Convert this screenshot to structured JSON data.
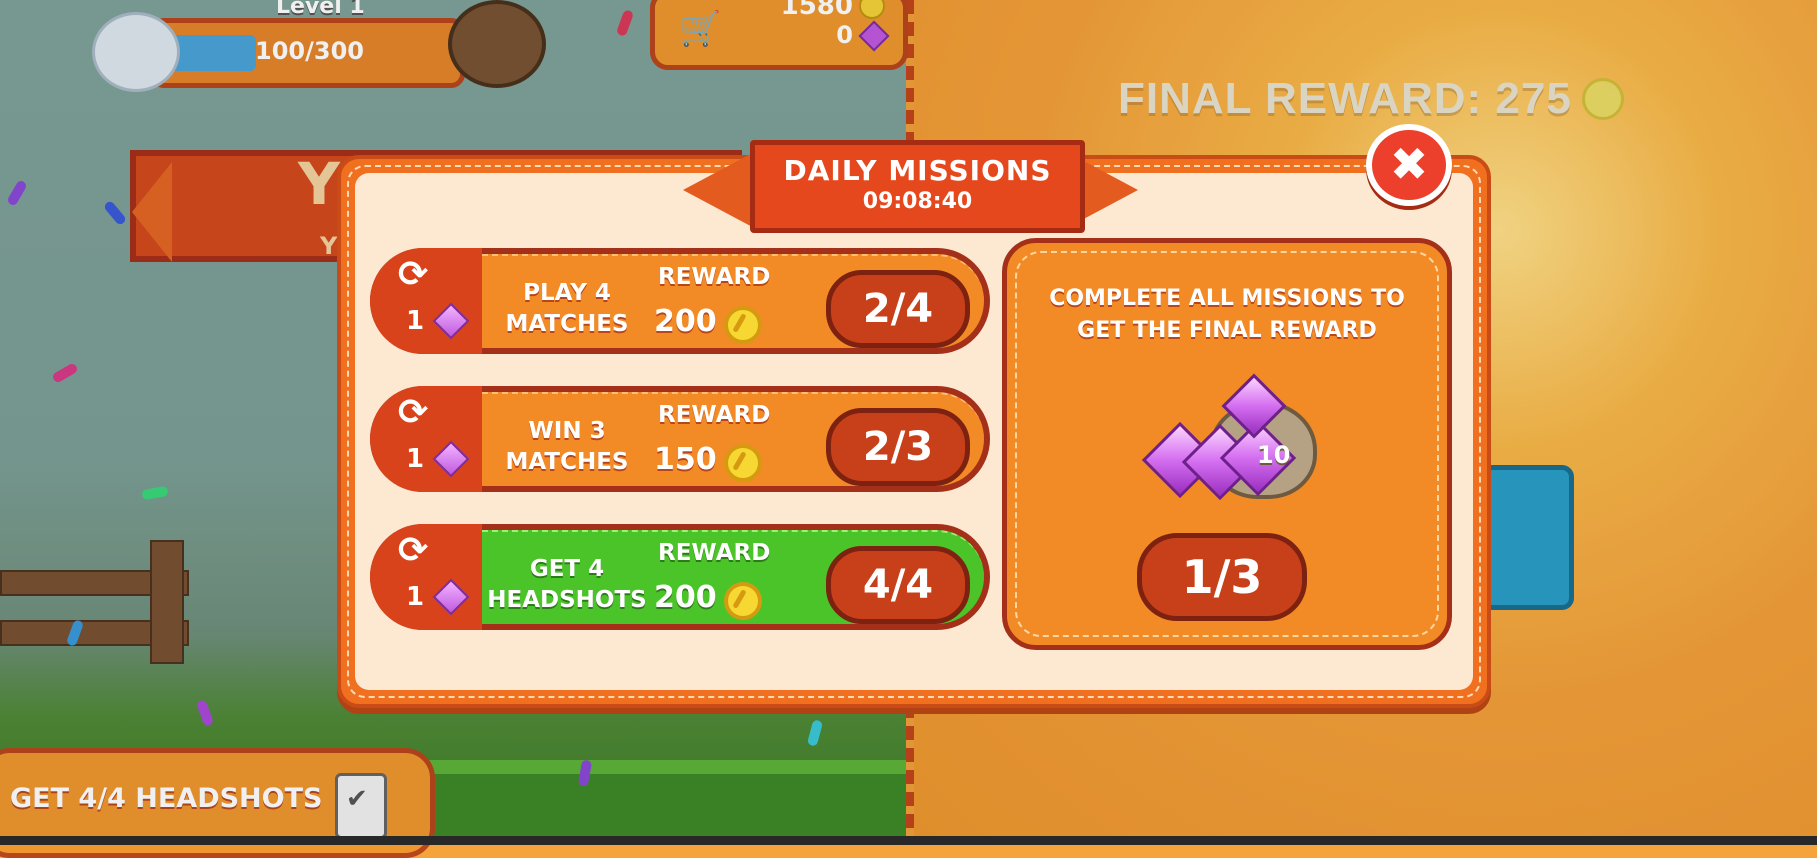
{
  "hud": {
    "level_label": "Level 1",
    "xp_text": "100/300",
    "xp_progress": 0.33,
    "coins": "1580",
    "gems": "0"
  },
  "background": {
    "final_reward_label": "FINAL REWARD: 275",
    "banner_text": "Y",
    "banner_subtext": "Y",
    "bottom_task": "GET 4/4 HEADSHOTS"
  },
  "modal": {
    "title": "DAILY MISSIONS",
    "timer": "09:08:40",
    "close_icon": "close-icon",
    "missions": [
      {
        "name_line1": "PLAY 4",
        "name_line2": "MATCHES",
        "cost": "1",
        "reward_label": "REWARD",
        "reward": "200",
        "progress": "2/4",
        "completed": false
      },
      {
        "name_line1": "WIN 3",
        "name_line2": "MATCHES",
        "cost": "1",
        "reward_label": "REWARD",
        "reward": "150",
        "progress": "2/3",
        "completed": false
      },
      {
        "name_line1": "GET 4",
        "name_line2": "HEADSHOTS",
        "cost": "1",
        "reward_label": "REWARD",
        "reward": "200",
        "progress": "4/4",
        "completed": true
      }
    ],
    "final": {
      "description_line1": "COMPLETE ALL MISSIONS TO",
      "description_line2": "GET THE FINAL REWARD",
      "sack_amount": "10",
      "progress": "1/3"
    }
  },
  "colors": {
    "modal_orange": "#f1701f",
    "modal_cream": "#fde8d2",
    "ribbon_red": "#e6481d",
    "mission_orange": "#f28b26",
    "mission_green": "#4bc42a",
    "pill_red": "#c8401a"
  }
}
